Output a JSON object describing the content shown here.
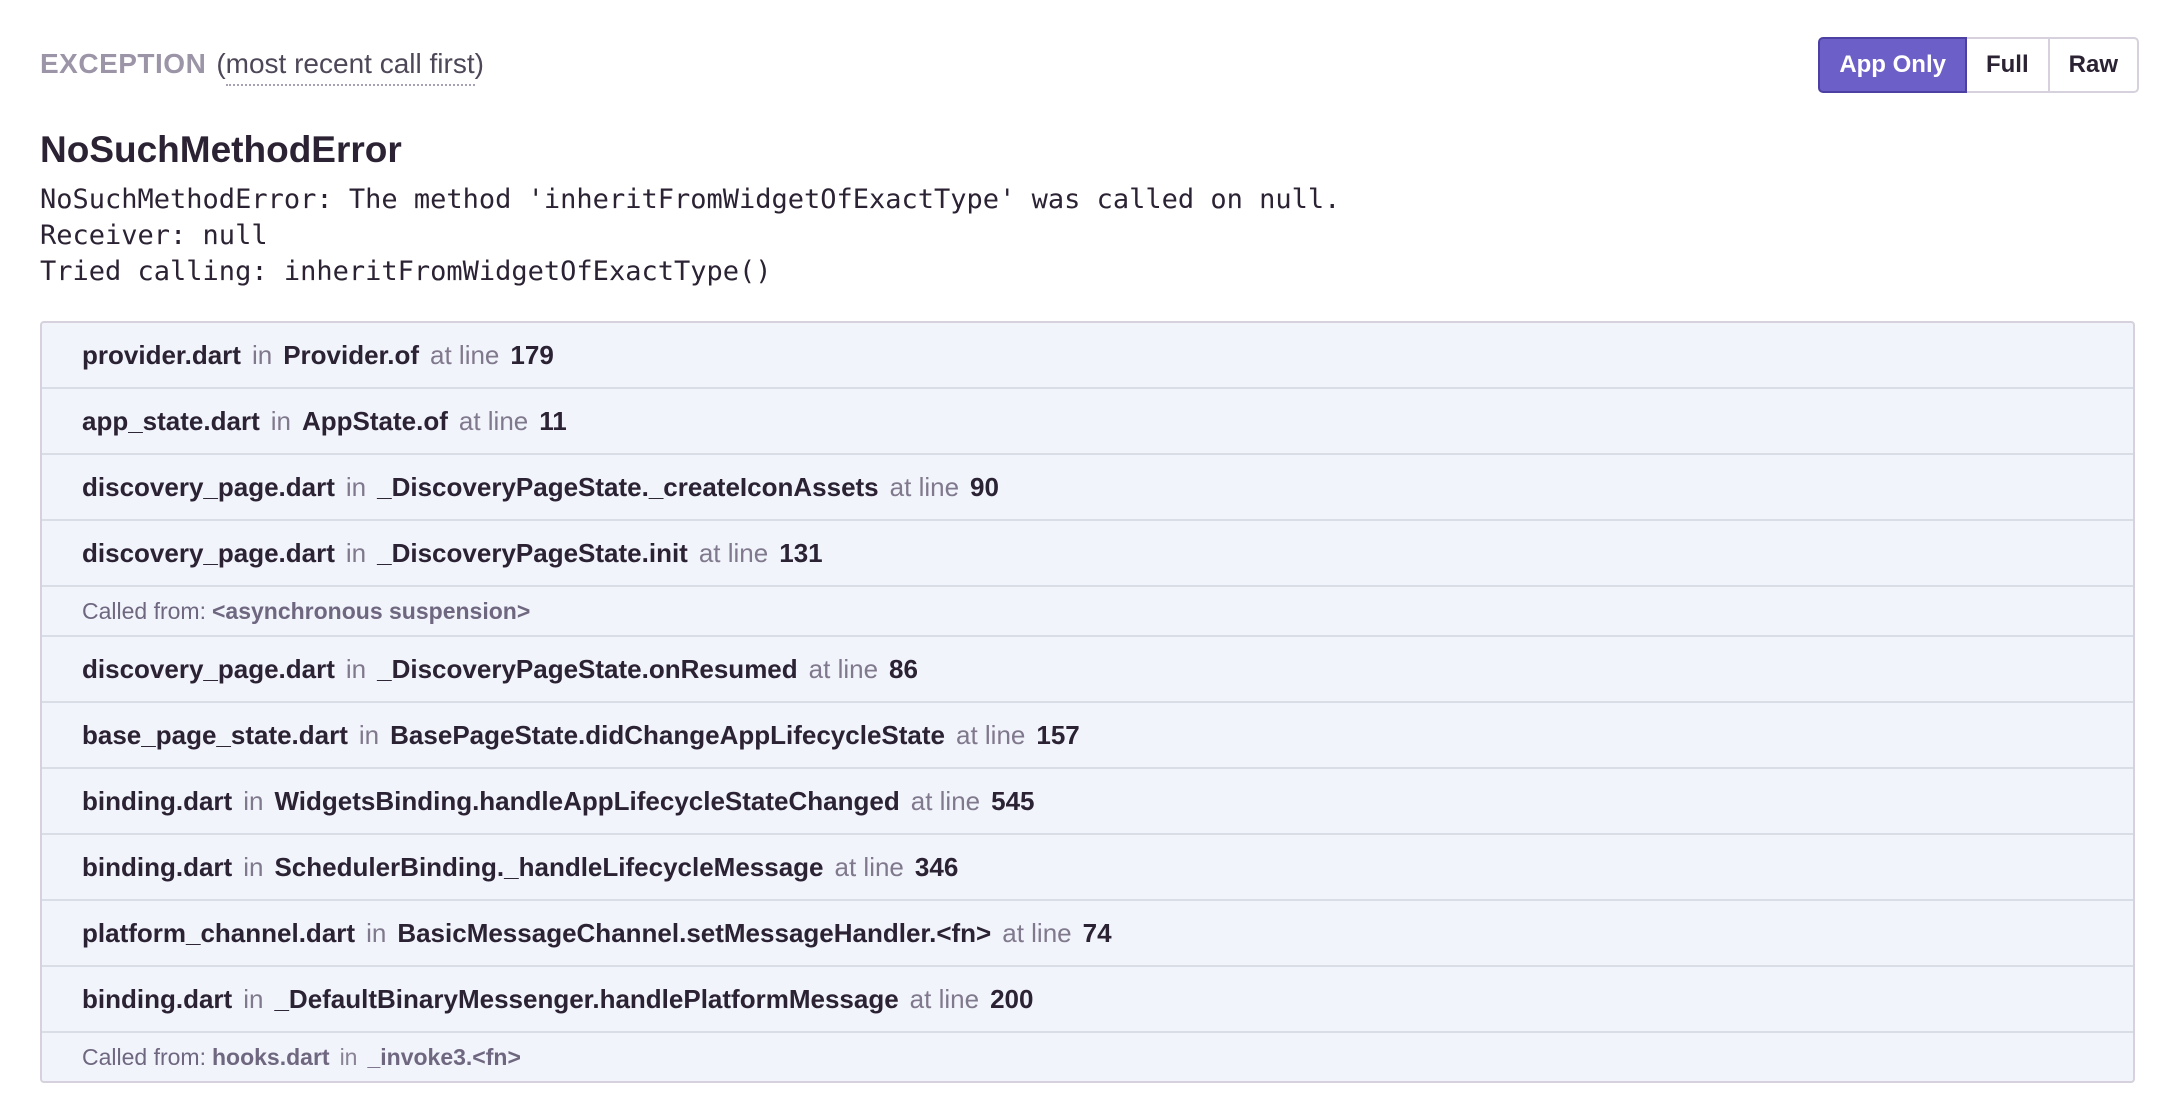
{
  "header": {
    "kind": "EXCEPTION",
    "open_paren": "(",
    "hint": "most recent call first",
    "close_paren": ")"
  },
  "view_toggle": {
    "app_only": "App Only",
    "full": "Full",
    "raw": "Raw",
    "active": "App Only"
  },
  "exception": {
    "type": "NoSuchMethodError",
    "message_lines": [
      "NoSuchMethodError: The method 'inheritFromWidgetOfExactType' was called on null.",
      "Receiver: null",
      "Tried calling: inheritFromWidgetOfExactType()"
    ]
  },
  "labels": {
    "in": "in",
    "at_line": "at line",
    "called_from": "Called from:"
  },
  "frames": [
    {
      "file": "provider.dart",
      "func": "Provider.of",
      "line": "179"
    },
    {
      "file": "app_state.dart",
      "func": "AppState.of",
      "line": "11"
    },
    {
      "file": "discovery_page.dart",
      "func": "_DiscoveryPageState._createIconAssets",
      "line": "90"
    },
    {
      "file": "discovery_page.dart",
      "func": "_DiscoveryPageState.init",
      "line": "131"
    },
    {
      "called_from": "<asynchronous suspension>"
    },
    {
      "file": "discovery_page.dart",
      "func": "_DiscoveryPageState.onResumed",
      "line": "86"
    },
    {
      "file": "base_page_state.dart",
      "func": "BasePageState.didChangeAppLifecycleState",
      "line": "157"
    },
    {
      "file": "binding.dart",
      "func": "WidgetsBinding.handleAppLifecycleStateChanged",
      "line": "545"
    },
    {
      "file": "binding.dart",
      "func": "SchedulerBinding._handleLifecycleMessage",
      "line": "346"
    },
    {
      "file": "platform_channel.dart",
      "func": "BasicMessageChannel.setMessageHandler.<fn>",
      "line": "74"
    },
    {
      "file": "binding.dart",
      "func": "_DefaultBinaryMessenger.handlePlatformMessage",
      "line": "200"
    },
    {
      "called_from_file": "hooks.dart",
      "called_from_func": "_invoke3.<fn>"
    }
  ]
}
